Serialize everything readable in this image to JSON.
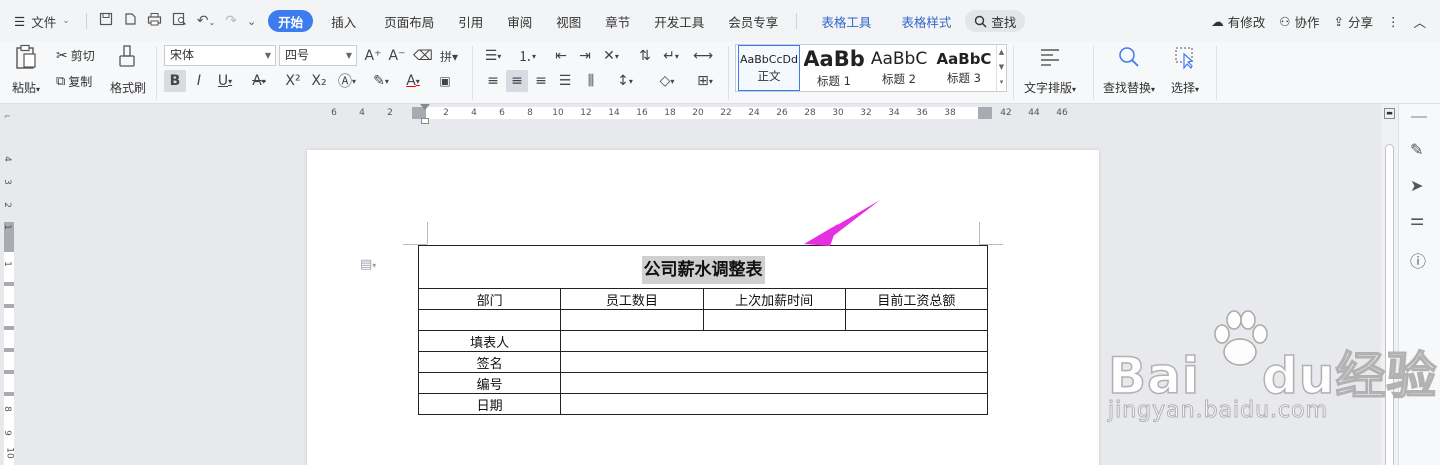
{
  "menu": {
    "file": "文件",
    "tabs": [
      "开始",
      "插入",
      "页面布局",
      "引用",
      "审阅",
      "视图",
      "章节",
      "开发工具",
      "会员专享"
    ],
    "context_tabs": [
      "表格工具",
      "表格样式"
    ],
    "search": "查找",
    "right": {
      "modified": "有修改",
      "collab": "协作",
      "share": "分享"
    }
  },
  "ribbon": {
    "paste": "粘贴",
    "cut": "剪切",
    "copy": "复制",
    "format_painter": "格式刷",
    "font_name": "宋体",
    "font_size": "四号",
    "styles": [
      {
        "preview": "AaBbCcDd",
        "name": "正文"
      },
      {
        "preview": "AaBb",
        "name": "标题 1"
      },
      {
        "preview": "AaBbC",
        "name": "标题 2"
      },
      {
        "preview": "AaBbC",
        "name": "标题 3"
      }
    ],
    "text_layout": "文字排版",
    "find_replace": "查找替换",
    "select": "选择"
  },
  "ruler": {
    "h_ticks": [
      "6",
      "4",
      "2",
      "2",
      "4",
      "6",
      "8",
      "10",
      "12",
      "14",
      "16",
      "18",
      "20",
      "22",
      "24",
      "26",
      "28",
      "30",
      "32",
      "34",
      "36",
      "38",
      "42",
      "44",
      "46"
    ],
    "v_ticks": [
      "4",
      "3",
      "2",
      "1",
      "1",
      "8",
      "9",
      "10"
    ]
  },
  "document": {
    "title": "公司薪水调整表",
    "headers": [
      "部门",
      "员工数目",
      "上次加薪时间",
      "目前工资总额"
    ],
    "rows": [
      "填表人",
      "签名",
      "编号",
      "日期"
    ]
  },
  "watermark": {
    "brand": "Bai",
    "brand2": "du",
    "brand3": "经验",
    "url": "jingyan.baidu.com"
  },
  "colors": {
    "accent": "#3c7cf0",
    "arrow": "#e62fe0",
    "context_tab": "#3267c9"
  }
}
